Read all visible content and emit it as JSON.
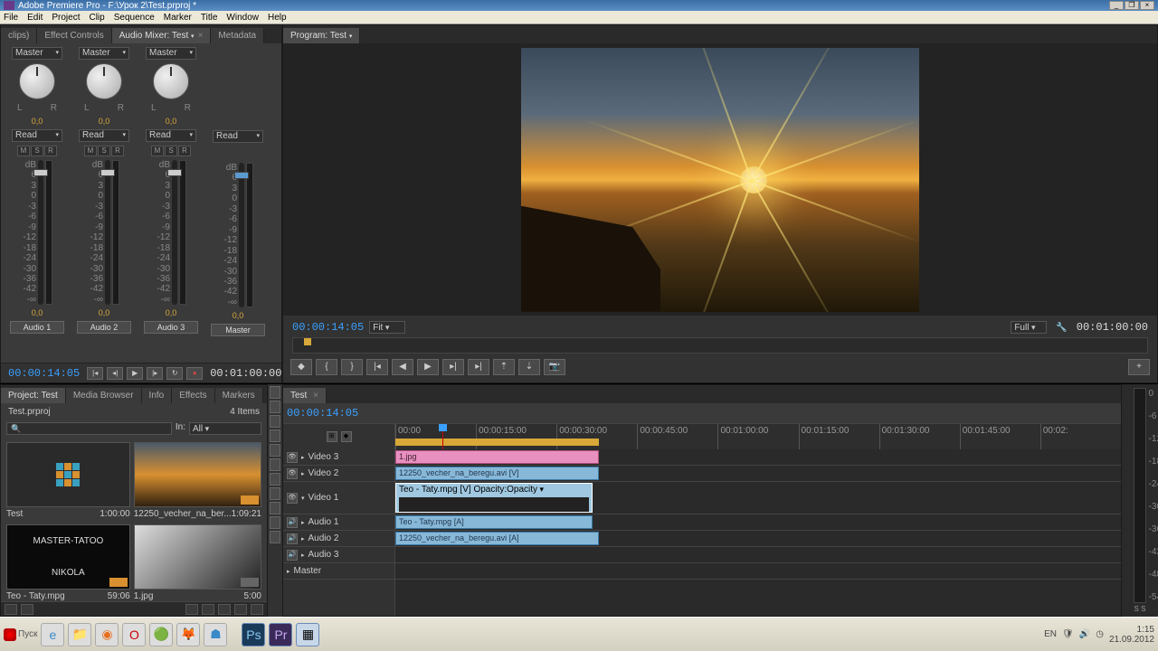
{
  "title": "Adobe Premiere Pro - F:\\Урок 2\\Test.prproj *",
  "menu": [
    "File",
    "Edit",
    "Project",
    "Clip",
    "Sequence",
    "Marker",
    "Title",
    "Window",
    "Help"
  ],
  "top_tabs": {
    "clips": "clips)",
    "fx": "Effect Controls",
    "mix": "Audio Mixer: Test",
    "meta": "Metadata"
  },
  "mixer": {
    "master_label": "Master",
    "read_label": "Read",
    "msr": [
      "M",
      "S",
      "R"
    ],
    "scale": [
      "dB",
      "6",
      "3",
      "0",
      "-3",
      "-6",
      "-9",
      "-12",
      "-18",
      "-24",
      "-30",
      "-36",
      "-42",
      "-∞"
    ],
    "val": "0,0",
    "channels": [
      "Audio 1",
      "Audio 2",
      "Audio 3",
      "Master"
    ],
    "tc_in": "00:00:14:05",
    "tc_out": "00:01:00:00"
  },
  "program": {
    "tab": "Program: Test",
    "tc": "00:00:14:05",
    "fit": "Fit",
    "full": "Full",
    "dur": "00:01:00:00"
  },
  "project": {
    "tabs": [
      "Project: Test",
      "Media Browser",
      "Info",
      "Effects",
      "Markers"
    ],
    "name": "Test.prproj",
    "count": "4 Items",
    "in": "In:",
    "all": "All",
    "items": [
      {
        "name": "Test",
        "dur": "1:00:00"
      },
      {
        "name": "12250_vecher_na_ber...",
        "dur": "1:09:21"
      },
      {
        "name": "Teo - Taty.mpg",
        "dur": "59:06",
        "t1": "MASTER-TATOO",
        "t2": "NIKOLA"
      },
      {
        "name": "1.jpg",
        "dur": "5:00"
      }
    ]
  },
  "timeline": {
    "tab": "Test",
    "tc": "00:00:14:05",
    "ticks": [
      "00:00",
      "00:00:15:00",
      "00:00:30:00",
      "00:00:45:00",
      "00:01:00:00",
      "00:01:15:00",
      "00:01:30:00",
      "00:01:45:00",
      "00:02:"
    ],
    "tracks": {
      "v3": "Video 3",
      "v2": "Video 2",
      "v1": "Video 1",
      "a1": "Audio 1",
      "a2": "Audio 2",
      "a3": "Audio 3",
      "master": "Master"
    },
    "clips": {
      "v3": "1.jpg",
      "v2": "12250_vecher_na_beregu.avi [V]",
      "v1": "Teo - Taty.mpg [V] Opacity:Opacity",
      "a1": "Teo - Taty.mpg [A]",
      "a2": "12250_vecher_na_beregu.avi [A]"
    }
  },
  "meter_scale": [
    "0",
    "-6",
    "-12",
    "-18",
    "-24",
    "-30",
    "-36",
    "-42",
    "-48",
    "-54"
  ],
  "taskbar": {
    "start": "Пуск",
    "lang": "EN",
    "time": "1:15",
    "date": "21.09.2012"
  }
}
